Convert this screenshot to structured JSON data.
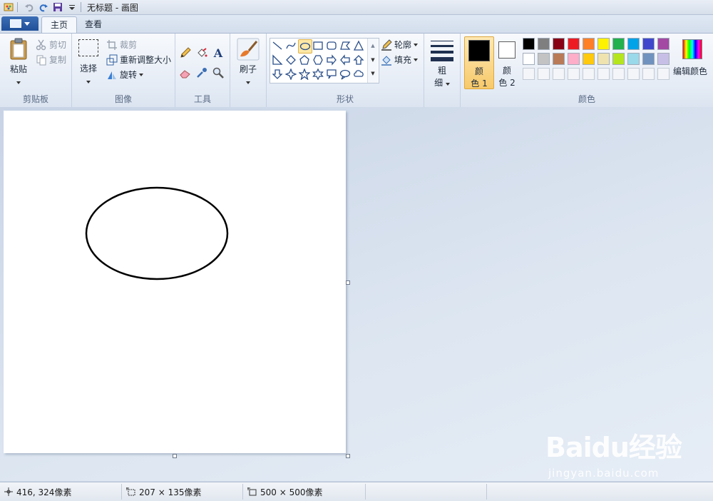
{
  "titlebar": {
    "title": "无标题 - 画图"
  },
  "tabs": {
    "home": "主页",
    "view": "查看"
  },
  "clipboard": {
    "paste": "粘贴",
    "cut": "剪切",
    "copy": "复制",
    "group": "剪贴板"
  },
  "image": {
    "select": "选择",
    "crop": "裁剪",
    "resize": "重新调整大小",
    "rotate": "旋转",
    "group": "图像"
  },
  "tools": {
    "group": "工具"
  },
  "brush": {
    "label": "刷子"
  },
  "shapes": {
    "outline": "轮廓",
    "fill": "填充",
    "group": "形状"
  },
  "size": {
    "label1": "粗",
    "label2": "细"
  },
  "colors": {
    "color1_a": "颜",
    "color1_b": "色 1",
    "color2_a": "颜",
    "color2_b": "色 2",
    "edit": "编辑颜色",
    "group": "颜色",
    "row1": [
      "#000000",
      "#7f7f7f",
      "#880015",
      "#ed1c24",
      "#ff7f27",
      "#fff200",
      "#22b14c",
      "#00a2e8",
      "#3f48cc",
      "#a349a4"
    ],
    "row2": [
      "#ffffff",
      "#c3c3c3",
      "#b97a57",
      "#ffaec9",
      "#ffc90e",
      "#efe4b0",
      "#b5e61d",
      "#99d9ea",
      "#7092be",
      "#c8bfe7"
    ],
    "primary": "#000000",
    "secondary": "#ffffff"
  },
  "status": {
    "cursor": "416, 324像素",
    "selection": "207 × 135像素",
    "canvas_size": "500 × 500像素"
  },
  "watermark": {
    "logo": "Baidu经验",
    "sub": "jingyan.baidu.com"
  }
}
